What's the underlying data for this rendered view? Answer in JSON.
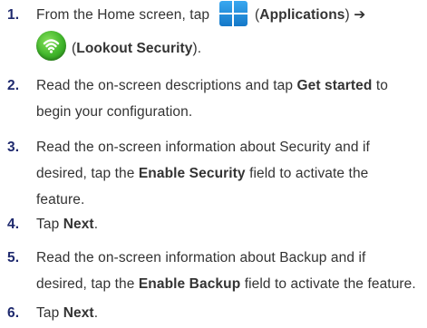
{
  "steps": [
    {
      "num": "1.",
      "line1_a": "From the Home screen, tap",
      "apps_label": "Applications",
      "paren_open": "(",
      "paren_close": ")",
      "arrow": "➔",
      "lookout_label": "Lookout Security",
      "end": ")."
    },
    {
      "num": "2.",
      "a": "Read the on-screen descriptions and tap ",
      "b": "Get started",
      "c": " to",
      "line2": "begin your configuration."
    },
    {
      "num": "3.",
      "line1": "Read the on-screen information about Security and if",
      "line2_a": "desired, tap the ",
      "line2_b": "Enable Security",
      "line2_c": " field to activate the",
      "line3": "feature."
    },
    {
      "num": "4.",
      "a": "Tap ",
      "b": "Next",
      "c": "."
    },
    {
      "num": "5.",
      "line1": "Read the on-screen information about Backup and if",
      "line2_a": "desired, tap the ",
      "line2_b": "Enable Backup",
      "line2_c": " field to activate the feature."
    },
    {
      "num": "6.",
      "a": "Tap ",
      "b": "Next",
      "c": "."
    }
  ],
  "icons": {
    "apps": "applications-icon",
    "lookout": "lookout-security-icon",
    "apps_color": "#1a7fd0",
    "lookout_color": "#3fb42a"
  }
}
